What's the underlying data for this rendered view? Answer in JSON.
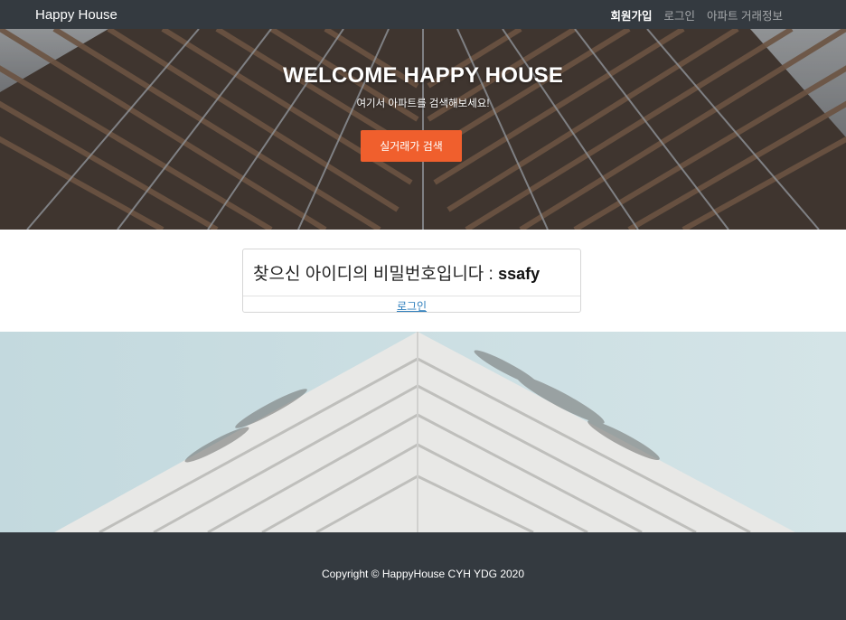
{
  "nav": {
    "brand": "Happy House",
    "links": [
      "회원가입",
      "로그인",
      "아파트 거래정보"
    ]
  },
  "hero": {
    "title": "WELCOME HAPPY HOUSE",
    "subtitle": "여기서 아파트를 검색해보세요!",
    "button": "실거래가 검색"
  },
  "result": {
    "message": "찾으신 아이디의 비밀번호입니다 : ",
    "password": "ssafy",
    "link": "로그인"
  },
  "footer": {
    "copyright": "Copyright © HappyHouse CYH YDG 2020"
  },
  "colors": {
    "navbar": "#343a40",
    "accent_button": "#f05f2d",
    "link": "#2f7fbd"
  }
}
